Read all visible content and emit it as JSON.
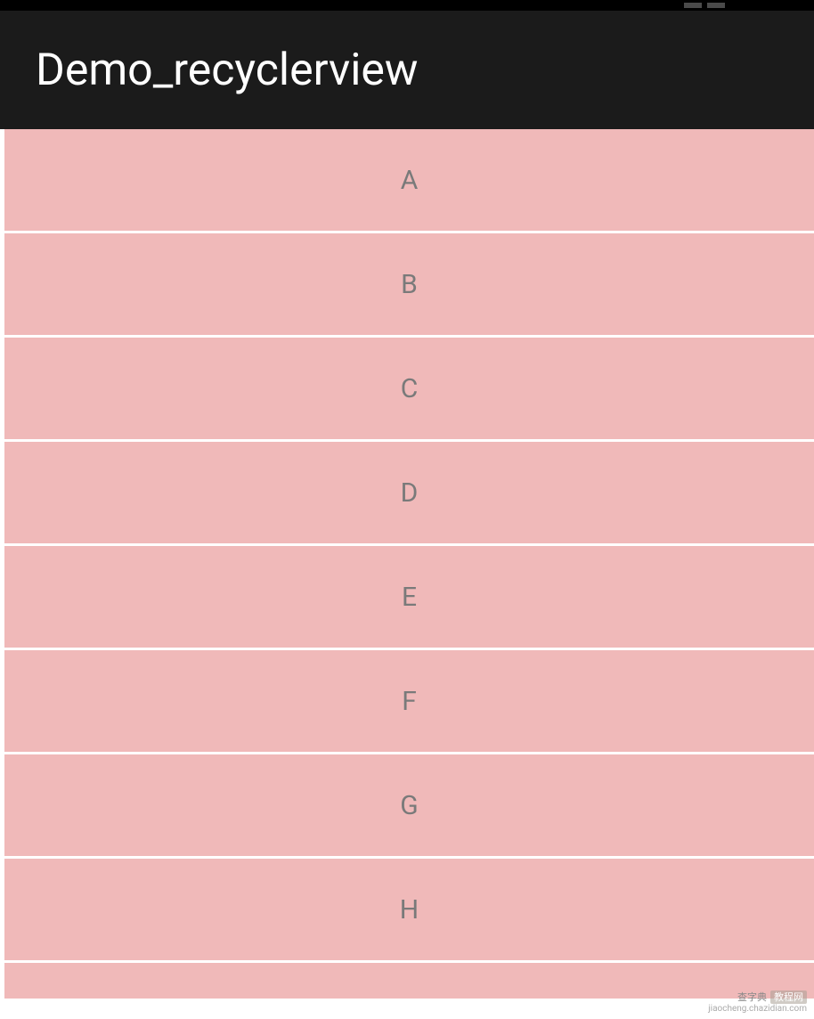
{
  "statusBar": {
    "icons": [
      "signal-icon",
      "menu-icon"
    ]
  },
  "appBar": {
    "title": "Demo_recyclerview"
  },
  "list": {
    "items": [
      {
        "label": "A"
      },
      {
        "label": "B"
      },
      {
        "label": "C"
      },
      {
        "label": "D"
      },
      {
        "label": "E"
      },
      {
        "label": "F"
      },
      {
        "label": "G"
      },
      {
        "label": "H"
      }
    ]
  },
  "watermark": {
    "text": "查字典",
    "badge": "教程网",
    "url": "jiaocheng.chazidian.com"
  },
  "colors": {
    "statusBar": "#000000",
    "appBar": "#1b1b1b",
    "itemBackground": "#f0b9b9",
    "itemDivider": "#ffffff",
    "itemText": "#7a7a7a",
    "titleText": "#ffffff"
  }
}
